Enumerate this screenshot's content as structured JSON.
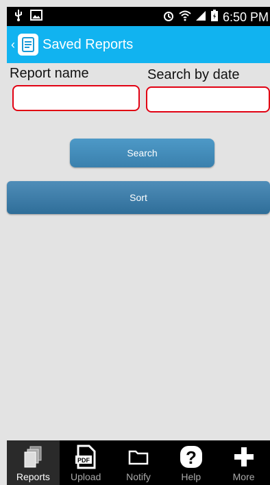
{
  "status_bar": {
    "time": "6:50 PM"
  },
  "app_bar": {
    "title": "Saved Reports"
  },
  "form": {
    "report_name_label": "Report name",
    "search_date_label": "Search by date",
    "report_name_value": "",
    "search_date_value": ""
  },
  "buttons": {
    "search_label": "Search",
    "sort_label": "Sort"
  },
  "tabs": [
    {
      "label": "Reports",
      "icon": "reports-icon"
    },
    {
      "label": "Upload",
      "icon": "pdf-icon"
    },
    {
      "label": "Notify",
      "icon": "folder-icon"
    },
    {
      "label": "Help",
      "icon": "help-icon"
    },
    {
      "label": "More",
      "icon": "plus-icon"
    }
  ],
  "colors": {
    "accent": "#11b3f0",
    "input_border": "#e10012",
    "button": "#3a80ad"
  }
}
